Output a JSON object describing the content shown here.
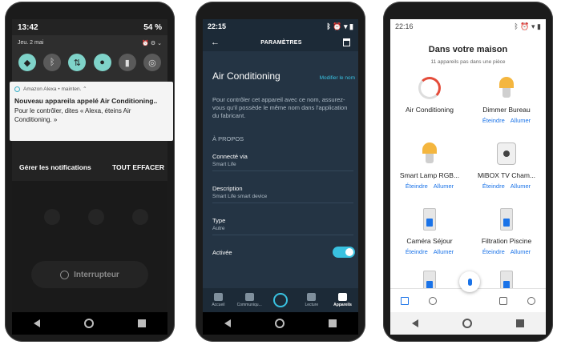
{
  "phone1": {
    "time": "13:42",
    "battery": "54 %",
    "date": "Jeu. 2 mai",
    "quick_tiles": [
      {
        "icon": "wifi-icon",
        "on": true
      },
      {
        "icon": "bluetooth-icon",
        "on": false
      },
      {
        "icon": "data-transfer-icon",
        "on": true
      },
      {
        "icon": "location-icon",
        "on": true
      },
      {
        "icon": "flashlight-icon",
        "on": false
      },
      {
        "icon": "hotspot-icon",
        "on": false
      }
    ],
    "notification": {
      "app": "Amazon Alexa • mainten. ⌃",
      "title": "Nouveau appareila appelé Air Conditioning..",
      "body": "Pour le contrôler, dites « Alexa, éteins Air Conditioning. »"
    },
    "manage_label": "Gérer les notifications",
    "clear_label": "TOUT EFFACER",
    "switch_label": "Interrupteur"
  },
  "phone2": {
    "time": "22:15",
    "header_title": "PARAMÈTRES",
    "device_name": "Air Conditioning",
    "rename_label": "Modifier le nom",
    "description": "Pour contrôler cet appareil avec ce nom, assurez-vous qu'il possède le même nom dans l'application du fabricant.",
    "about_label": "À PROPOS",
    "items": [
      {
        "key": "Connecté via",
        "value": "Smart Life"
      },
      {
        "key": "Description",
        "value": "Smart Life smart device"
      },
      {
        "key": "Type",
        "value": "Autre"
      }
    ],
    "active_label": "Activée",
    "active": true,
    "tabs": [
      {
        "label": "Accueil",
        "icon": "home-icon"
      },
      {
        "label": "Communiqu...",
        "icon": "chat-icon"
      },
      {
        "label": "",
        "icon": "alexa-icon"
      },
      {
        "label": "Lecture",
        "icon": "play-icon"
      },
      {
        "label": "Appareils",
        "icon": "devices-icon"
      }
    ],
    "accent": "#39c1e0"
  },
  "phone3": {
    "time": "22:16",
    "title": "Dans votre maison",
    "subtitle": "11 appareils pas dans une pièce",
    "off_label": "Éteindre",
    "on_label": "Allumer",
    "devices": [
      {
        "name": "Air Conditioning",
        "icon": "thermostat-icon",
        "actions": false
      },
      {
        "name": "Dimmer Bureau",
        "icon": "bulb-icon",
        "actions": true
      },
      {
        "name": "Smart Lamp RGB...",
        "icon": "bulb-icon",
        "actions": true
      },
      {
        "name": "MiBOX TV Cham...",
        "icon": "plug-icon",
        "actions": true
      },
      {
        "name": "Caméra Séjour",
        "icon": "switch-icon",
        "actions": true
      },
      {
        "name": "Filtration Piscine",
        "icon": "switch-icon",
        "actions": true
      }
    ],
    "accent": "#1a73e8"
  }
}
